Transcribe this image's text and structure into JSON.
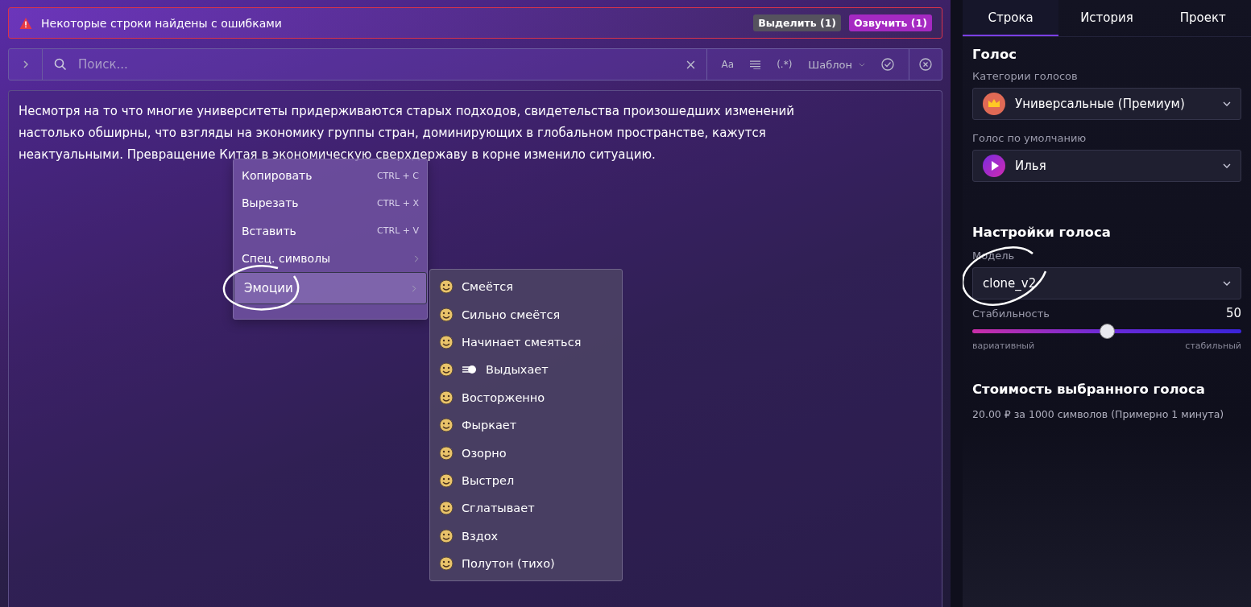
{
  "alert": {
    "message": "Некоторые строки найдены с ошибками",
    "buttons": [
      {
        "label": "Выделить (1)",
        "kind": "neutral"
      },
      {
        "label": "Озвучить (1)",
        "kind": "accent"
      }
    ]
  },
  "search": {
    "placeholder": "Поиск...",
    "options": [
      {
        "label": "Aa",
        "kind": "text"
      },
      {
        "kind": "lines"
      },
      {
        "label": "(.*)",
        "kind": "text"
      },
      {
        "label": "Шаблон",
        "kind": "dropdown"
      },
      {
        "kind": "check"
      }
    ]
  },
  "editor": {
    "text": "Несмотря на то что многие университеты придерживаются старых подходов, свидетельства произошедших изменений настолько обширны, что взгляды на экономику группы стран, доминирующих в глобальном пространстве, кажутся неактуальными. Превращение Китая в экономическую сверхдержаву в корне изменило ситуацию."
  },
  "context_menu": {
    "items": [
      {
        "label": "Копировать",
        "shortcut": "CTRL + C",
        "submenu": false,
        "selected": false
      },
      {
        "label": "Вырезать",
        "shortcut": "CTRL + X",
        "submenu": false,
        "selected": false
      },
      {
        "label": "Вставить",
        "shortcut": "CTRL + V",
        "submenu": false,
        "selected": false
      },
      {
        "label": "Спец. символы",
        "submenu": true,
        "selected": false
      },
      {
        "label": "Эмоции",
        "submenu": true,
        "selected": true
      }
    ]
  },
  "emotions_menu": {
    "items": [
      {
        "label": "Смеётся",
        "kind": "face"
      },
      {
        "label": "Сильно смеётся",
        "kind": "face"
      },
      {
        "label": "Начинает смеяться",
        "kind": "face"
      },
      {
        "label": "Выдыхает",
        "kind": "exhale"
      },
      {
        "label": "Восторженно",
        "kind": "face"
      },
      {
        "label": "Фыркает",
        "kind": "face"
      },
      {
        "label": "Озорно",
        "kind": "face"
      },
      {
        "label": "Выстрел",
        "kind": "face"
      },
      {
        "label": "Сглатывает",
        "kind": "face"
      },
      {
        "label": "Вздох",
        "kind": "face"
      },
      {
        "label": "Полутон (тихо)",
        "kind": "face"
      }
    ]
  },
  "tabs": [
    {
      "label": "Строка",
      "selected": true
    },
    {
      "label": "История",
      "selected": false
    },
    {
      "label": "Проект",
      "selected": false
    }
  ],
  "voice": {
    "title": "Голос",
    "category_label": "Категории голосов",
    "category": "Универсальные (Премиум)",
    "default_label": "Голос по умолчанию",
    "default_voice": "Илья"
  },
  "settings": {
    "title": "Настройки голоса",
    "model_label": "Модель",
    "model": "clone_v2",
    "stability_label": "Стабильность",
    "stability_value": "50",
    "level": 0.5,
    "min_label": "вариативный",
    "max_label": "стабильный"
  },
  "cost": {
    "title": "Стоимость выбранного голоса",
    "text": "20.00 ₽ за 1000 символов (Примерно 1 минута)"
  }
}
